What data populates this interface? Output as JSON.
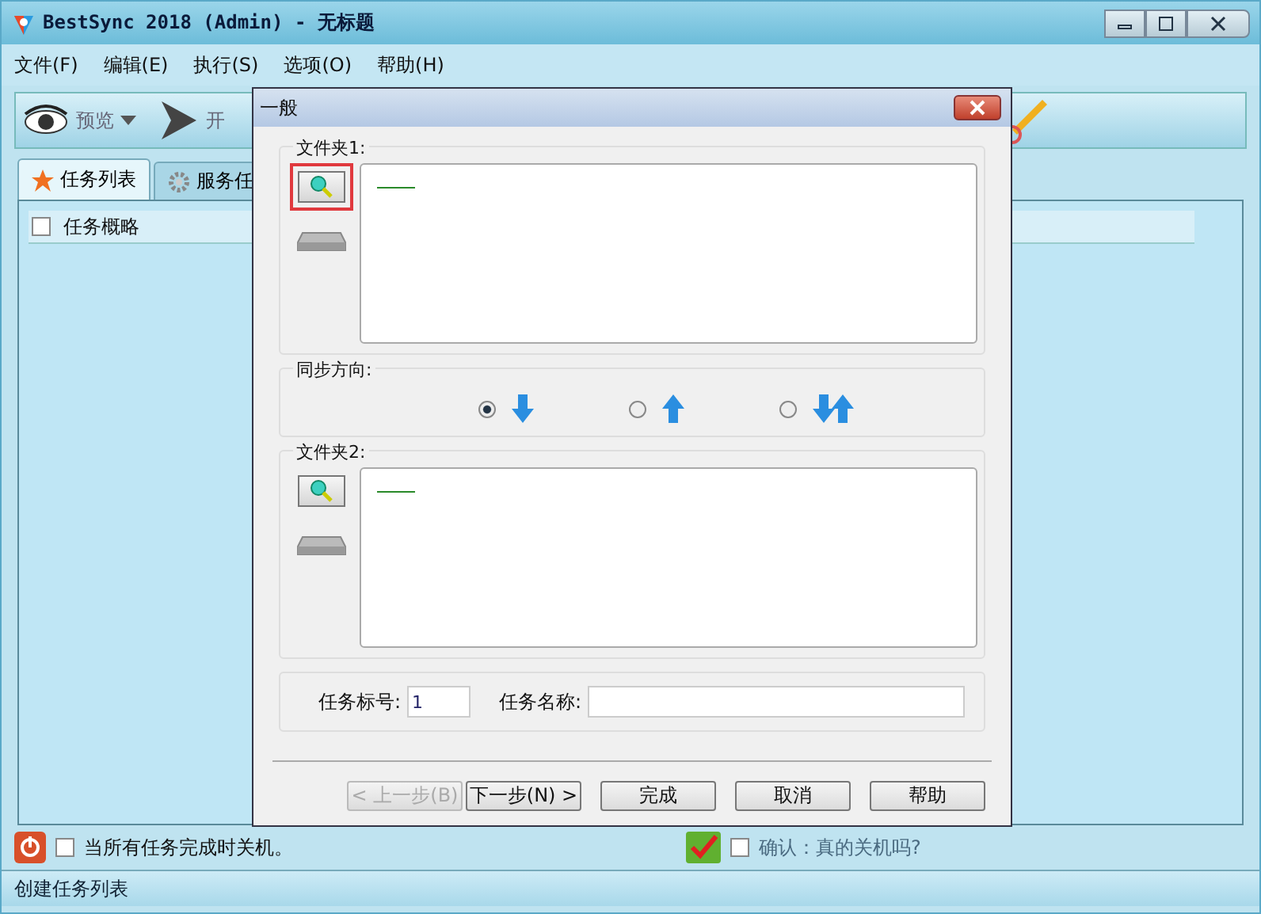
{
  "window": {
    "title": "BestSync 2018 (Admin) - 无标题"
  },
  "menu": [
    "文件(F)",
    "编辑(E)",
    "执行(S)",
    "选项(O)",
    "帮助(H)"
  ],
  "toolbar": [
    {
      "label": "预览",
      "kind": "preview"
    },
    {
      "label": "开",
      "kind": "start"
    }
  ],
  "tabs": [
    {
      "label": "任务列表",
      "selected": true,
      "kind": "star"
    },
    {
      "label": "服务任",
      "selected": false,
      "kind": "gear"
    }
  ],
  "task_list": {
    "header": "任务概略",
    "checked": false
  },
  "shutdown": {
    "label": "当所有任务完成时关机。",
    "checked": false
  },
  "confirm": {
    "label": "确认：真的关机吗?",
    "checked": false
  },
  "status_bar": "创建任务列表",
  "dialog": {
    "title": "一般",
    "folder1": {
      "label": "文件夹1:",
      "highlighted": true
    },
    "direction": {
      "label": "同步方向:",
      "options": [
        {
          "kind": "down",
          "selected": true
        },
        {
          "kind": "up",
          "selected": false
        },
        {
          "kind": "both",
          "selected": false
        }
      ]
    },
    "folder2": {
      "label": "文件夹2:",
      "highlighted": false
    },
    "task_number": {
      "label": "任务标号:",
      "value": "1"
    },
    "task_name": {
      "label": "任务名称:"
    },
    "buttons": [
      {
        "label": "< 上一步(B)",
        "disabled": true
      },
      {
        "label": "下一步(N) >",
        "disabled": false
      },
      {
        "label": "完成",
        "disabled": false
      },
      {
        "label": "取消",
        "disabled": false
      },
      {
        "label": "帮助",
        "disabled": false
      }
    ]
  }
}
